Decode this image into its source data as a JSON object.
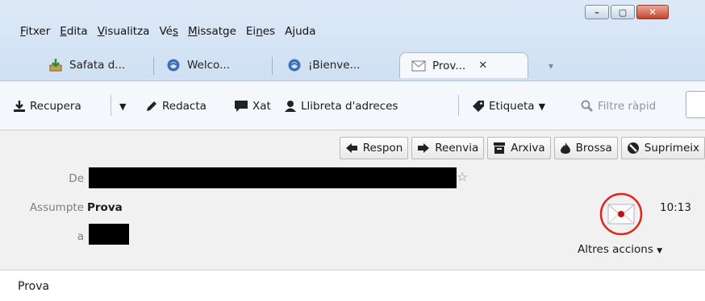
{
  "menu": {
    "items": [
      {
        "pre": "",
        "ul": "F",
        "post": "itxer"
      },
      {
        "pre": "",
        "ul": "E",
        "post": "dita"
      },
      {
        "pre": "",
        "ul": "V",
        "post": "isualitza"
      },
      {
        "pre": "Vé",
        "ul": "s",
        "post": ""
      },
      {
        "pre": "",
        "ul": "M",
        "post": "issatge"
      },
      {
        "pre": "Ei",
        "ul": "n",
        "post": "es"
      },
      {
        "pre": "A",
        "ul": "j",
        "post": "uda"
      }
    ]
  },
  "tabs": [
    {
      "label": "Safata d...",
      "icon": "inbox-icon"
    },
    {
      "label": "Welco...",
      "icon": "thunderbird-icon"
    },
    {
      "label": "¡Bienve...",
      "icon": "thunderbird-icon"
    },
    {
      "label": "Prov...",
      "icon": "envelope-icon",
      "active": true
    }
  ],
  "toolbar": {
    "get_mail": "Recupera",
    "write": "Redacta",
    "chat": "Xat",
    "address_book": "Llibreta d'adreces",
    "tag": "Etiqueta",
    "quick_filter": "Filtre ràpid"
  },
  "message_actions": {
    "reply": "Respon",
    "forward": "Reenvia",
    "archive": "Arxiva",
    "junk": "Brossa",
    "delete": "Suprimeix"
  },
  "header": {
    "from_label": "De",
    "subject_label": "Assumpte",
    "subject_value": "Prova",
    "to_label": "a",
    "time": "10:13",
    "other_actions": "Altres accions"
  },
  "body": {
    "text": "Prova"
  },
  "colors": {
    "frame": "#cfe0f3",
    "close_button": "#c5452b",
    "annotation_circle": "#e2231a"
  }
}
